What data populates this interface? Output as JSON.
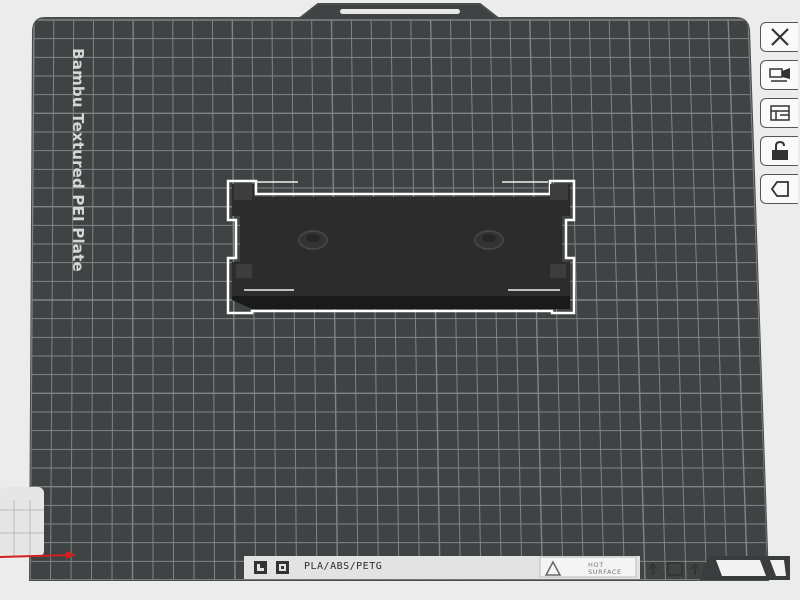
{
  "plate": {
    "name": "Bambu Textured PEI Plate",
    "materials": "PLA/ABS/PETG",
    "warning_line1": "HOT",
    "warning_line2": "SURFACE"
  },
  "colors": {
    "plate": "#3f4344",
    "grid": "#8c9091",
    "border": "#4a4d4e",
    "model_top": "#2c2c2c",
    "model_side": "#1c1c1c",
    "selection_outline": "#ffffff",
    "x_axis": "#d21e1e",
    "background": "#ececec"
  },
  "toolbar": {
    "items": [
      {
        "id": "close",
        "icon": "close-icon"
      },
      {
        "id": "auto-orient",
        "icon": "auto-orient-icon"
      },
      {
        "id": "arrange",
        "icon": "arrange-icon"
      },
      {
        "id": "lock",
        "icon": "unlock-icon"
      },
      {
        "id": "plate-settings",
        "icon": "plate-settings-icon"
      }
    ]
  }
}
